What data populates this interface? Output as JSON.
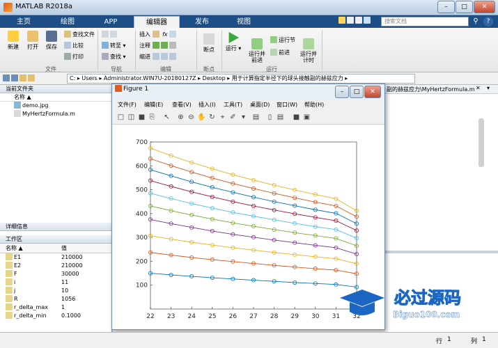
{
  "window": {
    "title": "MATLAB R2018a"
  },
  "tabs": [
    {
      "label": "主页"
    },
    {
      "label": "绘图"
    },
    {
      "label": "APP"
    },
    {
      "label": "编辑器"
    },
    {
      "label": "发布"
    },
    {
      "label": "视图"
    }
  ],
  "search": {
    "placeholder": "搜索文档"
  },
  "ribbon": {
    "file": {
      "new": "新建",
      "open": "打开",
      "save": "保存",
      "find_files": "查找文件",
      "compare": "比较",
      "print": "打印",
      "group": "文件"
    },
    "navigate": {
      "goto": "转至",
      "find": "查找",
      "group": "导航"
    },
    "edit": {
      "insert": "插入",
      "comment": "注释",
      "indent": "缩进",
      "fx": "fx",
      "group": "编辑"
    },
    "breakpoints": {
      "breakpoint": "断点",
      "group": "断点"
    },
    "run": {
      "run": "运行",
      "run_advance": "运行并\n前进",
      "run_section": "运行节",
      "advance": "前进",
      "run_time": "运行并\n计时",
      "group": "运行"
    }
  },
  "address": {
    "path_parts": [
      "C:",
      "Users",
      "Administrator.WIN7U-20180127Z",
      "Desktop",
      "用于计算指定半径下的球头接触副的赫兹应力"
    ],
    "editor_tab": "副的赫兹应力\\MyHertzFormula.m"
  },
  "current_folder": {
    "title": "当前文件夹",
    "col_name": "名称",
    "files": [
      {
        "name": "demo.jpg"
      },
      {
        "name": "MyHertzFormula.m"
      }
    ]
  },
  "details": {
    "title": "详细信息"
  },
  "workspace": {
    "title": "工作区",
    "col_name": "名称",
    "col_value": "值",
    "rows": [
      {
        "name": "E1",
        "value": "210000"
      },
      {
        "name": "E2",
        "value": "210000"
      },
      {
        "name": "F",
        "value": "30000"
      },
      {
        "name": "i",
        "value": "11"
      },
      {
        "name": "j",
        "value": "10"
      },
      {
        "name": "R",
        "value": "1056"
      },
      {
        "name": "r_delta_max",
        "value": "1"
      },
      {
        "name": "r_delta_min",
        "value": "0.1000"
      }
    ]
  },
  "figure": {
    "title": "Figure 1",
    "menu": [
      "文件(F)",
      "编辑(E)",
      "查看(V)",
      "插入(I)",
      "工具(T)",
      "桌面(D)",
      "窗口(W)",
      "帮助(H)"
    ]
  },
  "status": {
    "row_label": "行",
    "row_value": "1",
    "col_label": "列",
    "col_value": "1"
  },
  "watermark": {
    "text": "必过源码",
    "url": "Biguo100.com"
  },
  "chart_data": {
    "type": "line",
    "x": [
      22,
      23,
      24,
      25,
      26,
      27,
      28,
      29,
      30,
      31,
      32
    ],
    "xticks": [
      22,
      23,
      24,
      25,
      26,
      27,
      28,
      29,
      30,
      31,
      32
    ],
    "yticks": [
      100,
      200,
      300,
      400,
      500,
      600,
      700
    ],
    "xlim": [
      22,
      32
    ],
    "ylim": [
      0,
      700
    ],
    "grid": false,
    "series": [
      {
        "color": "#0072BD",
        "values": [
          150,
          143,
          137,
          131,
          126,
          121,
          116,
          111,
          107,
          103,
          92
        ]
      },
      {
        "color": "#D95319",
        "values": [
          237,
          226,
          216,
          207,
          199,
          191,
          183,
          176,
          169,
          163,
          148
        ]
      },
      {
        "color": "#EDB120",
        "values": [
          307,
          293,
          280,
          268,
          257,
          247,
          237,
          228,
          219,
          211,
          190
        ]
      },
      {
        "color": "#7E2F8E",
        "values": [
          375,
          358,
          342,
          327,
          313,
          301,
          289,
          278,
          267,
          257,
          230
        ]
      },
      {
        "color": "#77AC30",
        "values": [
          432,
          412,
          394,
          377,
          361,
          347,
          333,
          320,
          308,
          296,
          265
        ]
      },
      {
        "color": "#4DBEEE",
        "values": [
          485,
          463,
          442,
          423,
          405,
          389,
          374,
          359,
          345,
          333,
          297
        ]
      },
      {
        "color": "#A2142F",
        "values": [
          538,
          514,
          491,
          470,
          450,
          432,
          415,
          399,
          384,
          370,
          329
        ]
      },
      {
        "color": "#0072BD",
        "values": [
          584,
          558,
          533,
          510,
          489,
          469,
          450,
          433,
          416,
          401,
          358
        ]
      },
      {
        "color": "#D95319",
        "values": [
          630,
          601,
          574,
          549,
          526,
          505,
          485,
          466,
          448,
          432,
          387
        ]
      },
      {
        "color": "#EDB120",
        "values": [
          674,
          643,
          614,
          588,
          563,
          540,
          519,
          499,
          480,
          462,
          412
        ]
      }
    ]
  }
}
